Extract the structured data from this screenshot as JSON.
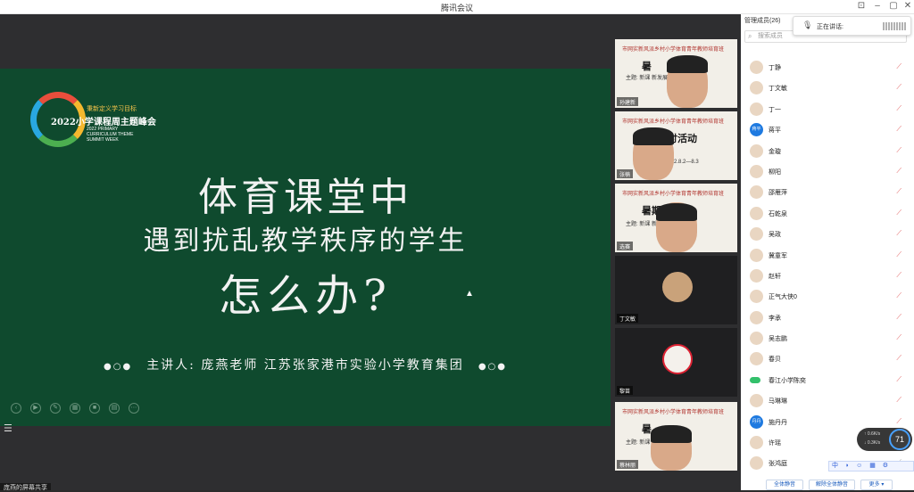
{
  "window": {
    "title": "腾讯会议"
  },
  "slide": {
    "logo_line1": "秉新定义学习目标",
    "logo_line2": "2022小学课程周主题峰会",
    "logo_line3": "2022 PRIMARY CURRICULUM THEME SUMMIT WEEK",
    "title_line1": "体育课堂中",
    "title_line2": "遇到扰乱教学秩序的学生",
    "title_line3": "怎么办?",
    "speaker": "主讲人: 庞燕老师    江苏张家港市实验小学教育集团",
    "dots_left": "●○●",
    "dots_right": "●○●"
  },
  "share_label": "庞燕的屏幕共享",
  "videos": [
    {
      "name": "孙建新",
      "banner": "市网实新风派乡村小学体育青年教师培育班",
      "big": "暑 ",
      "sub": "主题: 新课 新发展"
    },
    {
      "name": "张楠",
      "banner": "市网实新风派乡村小学体育青年教师培育班",
      "big": "研讨活动",
      "sub": "2022.8.2—8.3"
    },
    {
      "name": "选赛",
      "banner": "市网实新风派乡村小学体育青年教师培育班",
      "big": "暑期研 动",
      "sub": "主题: 新课 新发展"
    },
    {
      "name": "丁文敏"
    },
    {
      "name": "黎苗"
    },
    {
      "name": "蔡林丽",
      "banner": "市网实新风派乡村小学体育青年教师培育班",
      "big": "暑 ",
      "sub": "主题: 新课 新发展"
    }
  ],
  "panel": {
    "title": "管理成员(26)",
    "search_placeholder": "搜索成员",
    "speaking_label": "正在讲话:",
    "members": [
      {
        "name": "丁静",
        "avatar": "",
        "muted": true
      },
      {
        "name": "丁文敏",
        "avatar": "",
        "muted": true
      },
      {
        "name": "丁一",
        "avatar": "",
        "muted": true
      },
      {
        "name": "蒋平",
        "avatar": "蒋平",
        "muted": true,
        "blue": true
      },
      {
        "name": "金璇",
        "avatar": "",
        "muted": true
      },
      {
        "name": "柳阳",
        "avatar": "",
        "muted": true
      },
      {
        "name": "邵雁萍",
        "avatar": "",
        "muted": true
      },
      {
        "name": "石乾泉",
        "avatar": "",
        "muted": true
      },
      {
        "name": "吴政",
        "avatar": "",
        "muted": true
      },
      {
        "name": "冀童军",
        "avatar": "",
        "muted": true
      },
      {
        "name": "赵轩",
        "avatar": "",
        "muted": true
      },
      {
        "name": "正气大侠0",
        "avatar": "",
        "muted": true
      },
      {
        "name": "李承",
        "avatar": "",
        "muted": true
      },
      {
        "name": "吴志鹏",
        "avatar": "",
        "muted": true
      },
      {
        "name": "春贝",
        "avatar": "",
        "muted": true
      },
      {
        "name": "春江小学陈奕",
        "avatar": "",
        "muted": true,
        "toggle": true
      },
      {
        "name": "马琳琳",
        "avatar": "",
        "muted": true
      },
      {
        "name": "施丹丹",
        "avatar": "丹丹",
        "muted": true,
        "blue": true
      },
      {
        "name": "许瑶",
        "avatar": "",
        "muted": true
      },
      {
        "name": "张鸿庭",
        "avatar": "",
        "muted": false
      }
    ],
    "buttons": {
      "mute_all": "全体静音",
      "unmute_all": "解除全体静音",
      "more": "更多"
    }
  },
  "network": {
    "up": "0.6",
    "down": "0.3",
    "unit": "K/s",
    "percent": "71"
  },
  "ime": "中 ◗ ☺ ▦ ⚙",
  "colors": {
    "slide_bg": "#0f4a2e",
    "accent": "#1f7ae0"
  }
}
